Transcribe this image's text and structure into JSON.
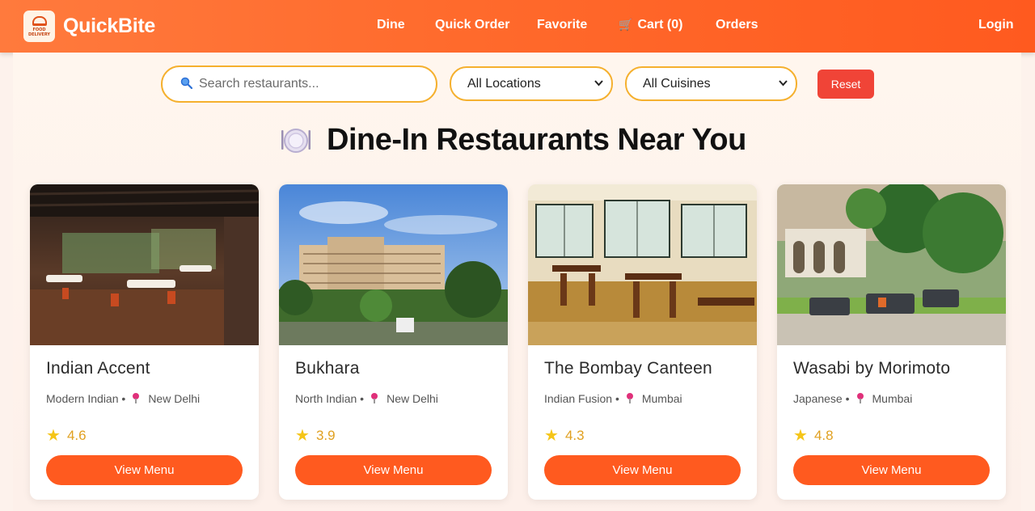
{
  "brand": {
    "name": "QuickBite",
    "logo_text": "FOOD DELIVERY"
  },
  "nav": {
    "dine": "Dine",
    "quick_order": "Quick Order",
    "favorite": "Favorite",
    "cart": "Cart (0)",
    "orders": "Orders",
    "login": "Login"
  },
  "filters": {
    "search_placeholder": "Search restaurants...",
    "location": "All Locations",
    "cuisine": "All Cuisines",
    "reset": "Reset"
  },
  "page": {
    "title": "Dine-In Restaurants Near You"
  },
  "restaurants": [
    {
      "name": "Indian Accent",
      "cuisine": "Modern Indian",
      "location": "New Delhi",
      "rating": "4.6",
      "button": "View Menu"
    },
    {
      "name": "Bukhara",
      "cuisine": "North Indian",
      "location": "New Delhi",
      "rating": "3.9",
      "button": "View Menu"
    },
    {
      "name": "The Bombay Canteen",
      "cuisine": "Indian Fusion",
      "location": "Mumbai",
      "rating": "4.3",
      "button": "View Menu"
    },
    {
      "name": "Wasabi by Morimoto",
      "cuisine": "Japanese",
      "location": "Mumbai",
      "rating": "4.8",
      "button": "View Menu"
    }
  ],
  "separator": "•",
  "colors": {
    "brand_orange": "#ff5a1f",
    "filter_border": "#f5b02e",
    "reset_red": "#f04437",
    "rating_gold": "#e0a020"
  }
}
